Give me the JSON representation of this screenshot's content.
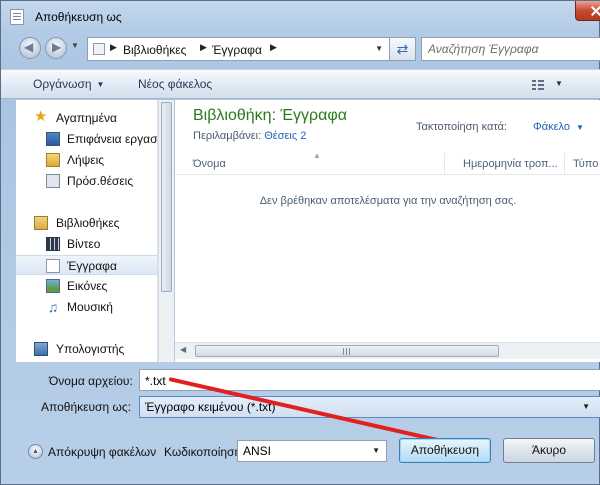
{
  "window": {
    "title": "Αποθήκευση ως"
  },
  "address": {
    "crumbs": [
      "Βιβλιοθήκες",
      "Έγγραφα"
    ]
  },
  "search": {
    "placeholder": "Αναζήτηση Έγγραφα"
  },
  "toolbar": {
    "organize": "Οργάνωση",
    "new_folder": "Νέος φάκελος"
  },
  "navpane": {
    "items": [
      {
        "label": "Αγαπημένα",
        "icon": "star-icon"
      },
      {
        "label": "Επιφάνεια εργασ",
        "icon": "desktop-icon"
      },
      {
        "label": "Λήψεις",
        "icon": "downloads-icon"
      },
      {
        "label": "Πρόσ.θέσεις",
        "icon": "recent-places-icon"
      },
      {
        "label": "Βιβλιοθήκες",
        "icon": "libraries-icon"
      },
      {
        "label": "Βίντεο",
        "icon": "video-icon"
      },
      {
        "label": "Έγγραφα",
        "icon": "documents-icon"
      },
      {
        "label": "Εικόνες",
        "icon": "pictures-icon"
      },
      {
        "label": "Μουσική",
        "icon": "music-icon"
      },
      {
        "label": "Υπολογιστής",
        "icon": "computer-icon"
      }
    ],
    "selected": "Έγγραφα"
  },
  "content": {
    "library_title": "Βιβλιοθήκη: Έγγραφα",
    "includes_label": "Περιλαμβάνει:",
    "locations_link": "Θέσεις 2",
    "arrange_label": "Τακτοποίηση κατά:",
    "arrange_value": "Φάκελο",
    "columns": [
      "Όνομα",
      "Ημερομηνία τροπ...",
      "Τύπο"
    ],
    "empty_message": "Δεν βρέθηκαν αποτελέσματα για την αναζήτηση σας."
  },
  "form": {
    "filename_label": "Όνομα αρχείου:",
    "filename_value": "*.txt",
    "savetype_label": "Αποθήκευση ως:",
    "savetype_value": "Έγγραφο κειμένου (*.txt)",
    "hide_folders_label": "Απόκρυψη φακέλων",
    "encoding_label": "Κωδικοποίηση:",
    "encoding_value": "ANSI",
    "save_button": "Αποθήκευση",
    "cancel_button": "Άκυρο"
  },
  "annotation": {
    "color": "#e32020"
  }
}
